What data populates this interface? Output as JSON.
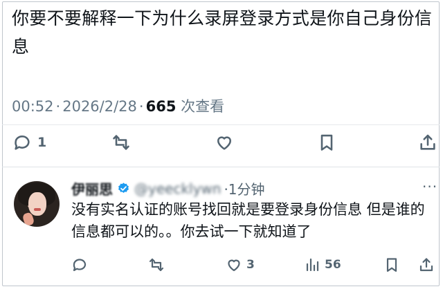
{
  "tweet": {
    "text": "你要不要解释一下为什么录屏登录方式是你自己身份信息",
    "time": "00:52",
    "date": "2026/2/28",
    "views_count": "665",
    "views_label": "次查看",
    "reply_count": "1"
  },
  "reply": {
    "author_name": "伊丽思",
    "handle": "@yeecklywn",
    "time": "·1分钟",
    "text": "没有实名认证的账号找回就是要登录身份信息 但是谁的信息都可以的。。你去试一下就知道了",
    "like_count": "3",
    "views_count": "56",
    "more": "···"
  },
  "colors": {
    "secondary": "#536471",
    "verified": "#1d9bf0"
  },
  "icons": [
    "reply-icon",
    "retweet-icon",
    "like-icon",
    "bookmark-icon",
    "share-icon",
    "views-icon",
    "verified-badge-icon",
    "more-icon"
  ]
}
